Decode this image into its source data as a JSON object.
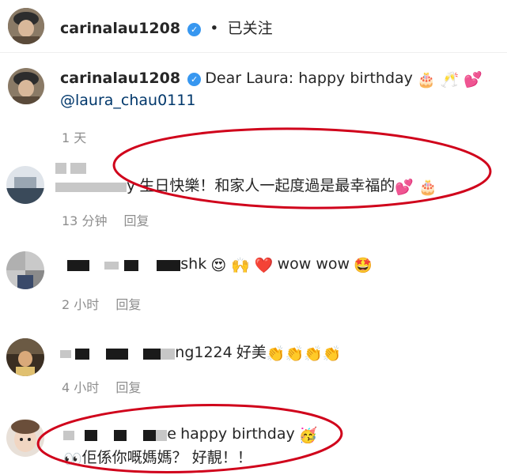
{
  "header": {
    "username": "carinalau1208",
    "separator": "•",
    "follow_status": "已关注"
  },
  "post": {
    "username": "carinalau1208",
    "caption": "Dear Laura: happy birthday",
    "caption_emojis": "🎂 🥂 💕",
    "mention": "@laura_chau0111",
    "time": "1 天"
  },
  "comments": [
    {
      "username_visible": "y",
      "text": "生日快樂！和家人一起度過是最幸福的",
      "emojis": "💕 🎂",
      "time": "13 分钟",
      "reply_label": "回复"
    },
    {
      "username_visible": "shk",
      "text": "wow wow",
      "emojis_before": "😍 🙌 ❤️",
      "emojis_after": "🤩",
      "time": "2 小时",
      "reply_label": "回复"
    },
    {
      "username_visible": "ng1224",
      "text": "好美",
      "emojis": "👏👏👏👏",
      "time": "4 小时",
      "reply_label": "回复"
    },
    {
      "username_visible": "e",
      "text": "happy birthday",
      "emojis": "🥳",
      "line2_emoji": "👀",
      "line2": "佢係你嘅媽媽？ 好靚！！",
      "reply_label": ""
    }
  ],
  "colors": {
    "annotation_oval": "#d0021b",
    "verified_badge": "#3797f0",
    "meta_text": "#8e8e8e",
    "mention": "#00376b"
  }
}
